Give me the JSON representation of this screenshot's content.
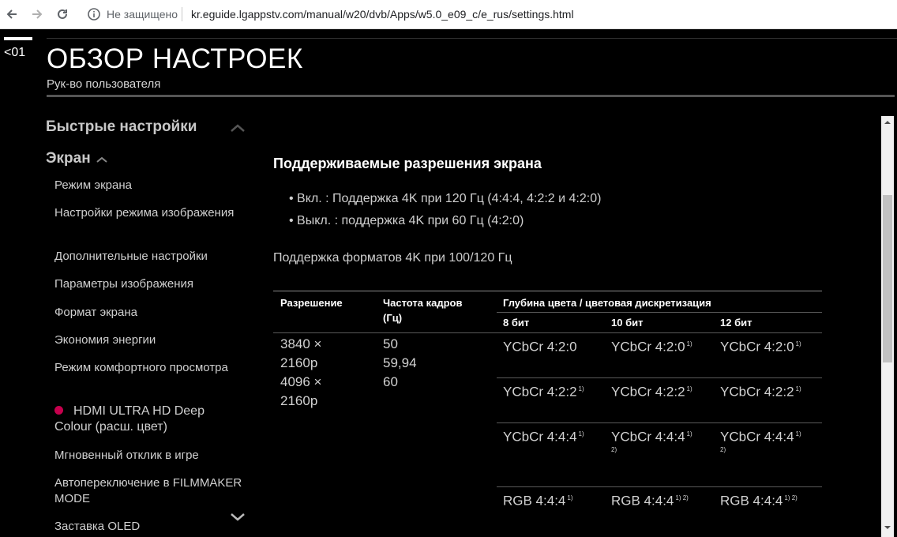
{
  "browser": {
    "security_status": "Не защищено",
    "url": "kr.eguide.lgappstv.com/manual/w20/dvb/Apps/w5.0_e09_c/e_rus/settings.html"
  },
  "header": {
    "back_label": "<01",
    "title": "ОБЗОР НАСТРОЕК",
    "subtitle": "Рук-во пользователя"
  },
  "sidebar": {
    "quick_settings_label": "Быстрые настройки",
    "screen_section_label": "Экран",
    "items": [
      {
        "label": "Режим экрана"
      },
      {
        "label": "Настройки режима изображения"
      },
      {
        "label": "Дополнительные настройки"
      },
      {
        "label": "Параметры изображения"
      },
      {
        "label": "Формат экрана"
      },
      {
        "label": "Экономия энергии"
      },
      {
        "label": "Режим комфортного просмотра"
      },
      {
        "label": "HDMI ULTRA HD Deep Colour (расш. цвет)"
      },
      {
        "label": "Мгновенный отклик в игре"
      },
      {
        "label": "Автопереключение в FILMMAKER MODE"
      },
      {
        "label": "Заставка OLED"
      }
    ]
  },
  "content": {
    "heading": "Поддерживаемые разрешения экрана",
    "bullets": [
      "Вкл. : Поддержка 4K при 120 Гц (4:4:4, 4:2:2 и 4:2:0)",
      "Выкл. : поддержка 4K при 60 Гц (4:2:0)"
    ],
    "formats_line": "Поддержка форматов 4K при 100/120 Гц",
    "table": {
      "col_resolution": "Разрешение",
      "col_framerate": "Частота кадров (Гц)",
      "col_colordepth": "Глубина цвета / цветовая дискретизация",
      "bit_8": "8 бит",
      "bit_10": "10 бит",
      "bit_12": "12 бит",
      "resolutions": [
        "3840 ×",
        "2160p",
        "4096 ×",
        "2160p"
      ],
      "framerates": [
        "50",
        "59,94",
        "60"
      ],
      "rows": [
        {
          "c8": "YCbCr 4:2:0",
          "c8_note": "",
          "c10": "YCbCr 4:2:0",
          "c10_note": "1)",
          "c12": "YCbCr 4:2:0",
          "c12_note": "1)"
        },
        {
          "c8": "YCbCr 4:2:2",
          "c8_note": "1)",
          "c10": "YCbCr 4:2:2",
          "c10_note": "1)",
          "c12": "YCbCr 4:2:2",
          "c12_note": "1)"
        },
        {
          "c8": "YCbCr 4:4:4",
          "c8_note": "1)",
          "c10": "YCbCr 4:4:4",
          "c10_note": "1)",
          "c10_note2": "2)",
          "c12": "YCbCr 4:4:4",
          "c12_note": "1)",
          "c12_note2": "2)"
        },
        {
          "c8": "RGB 4:4:4",
          "c8_note": "1)",
          "c10": "RGB 4:4:4",
          "c10_note": "1) 2)",
          "c12": "RGB 4:4:4",
          "c12_note": "1) 2)"
        }
      ]
    }
  },
  "colors": {
    "accent_dot": "#c6004d",
    "background": "#000000"
  }
}
